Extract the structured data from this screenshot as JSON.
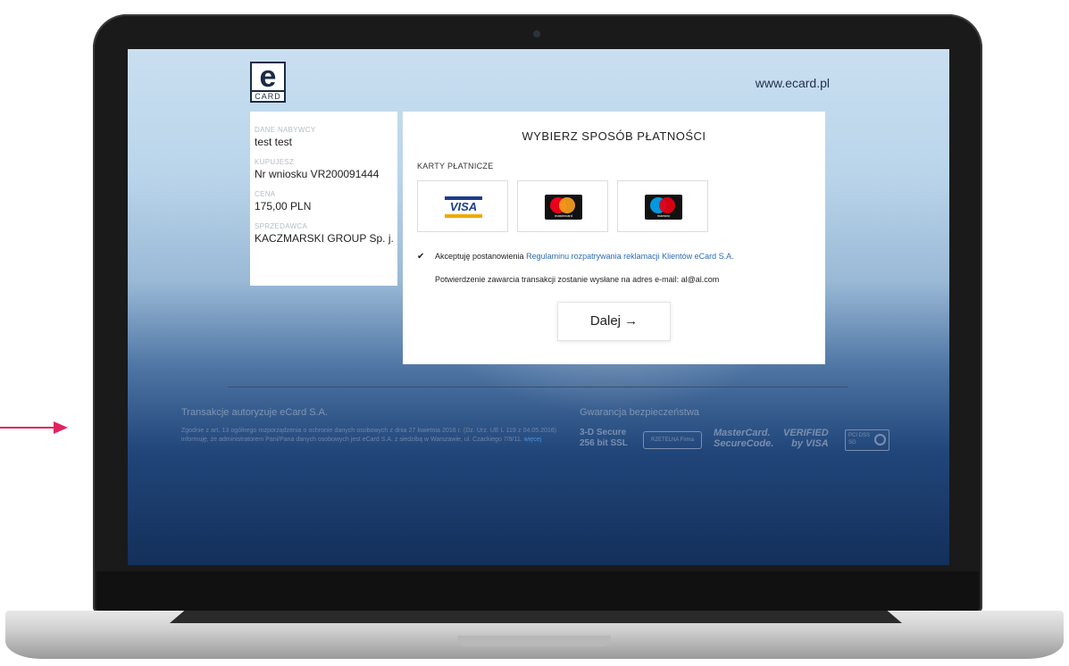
{
  "header": {
    "logo_letter": "e",
    "logo_text": "CARD",
    "site_url": "www.ecard.pl"
  },
  "buyer": {
    "fields": [
      {
        "label": "DANE NABYWCY",
        "value": "test test"
      },
      {
        "label": "KUPUJESZ",
        "value": "Nr wniosku VR200091444"
      },
      {
        "label": "CENA",
        "value": "175,00 PLN"
      },
      {
        "label": "SPRZEDAWCA",
        "value": "KACZMARSKI GROUP Sp. j."
      }
    ]
  },
  "payment": {
    "title": "WYBIERZ SPOSÓB PŁATNOŚCI",
    "cards_label": "KARTY PŁATNICZE",
    "cards": [
      {
        "name": "VISA",
        "icon": "visa-logo-icon"
      },
      {
        "name": "mastercard",
        "icon": "mastercard-logo-icon"
      },
      {
        "name": "maestro",
        "icon": "maestro-logo-icon"
      }
    ],
    "accept_prefix": "Akceptuję postanowienia ",
    "accept_link": "Regulaminu rozpatrywania reklamacji Klientów eCard S.A.",
    "email_note": "Potwierdzenie zawarcia transakcji zostanie wysłane na adres e-mail:  al@al.com",
    "next_label": "Dalej →"
  },
  "footer": {
    "auth_title": "Transakcje autoryzuje eCard S.A.",
    "gdpr_text": "Zgodnie z art. 13 ogólnego rozporządzenia o ochronie danych osobowych z dnia 27 kwietnia 2016 r. (Dz. Urz. UE L 119 z 04.05.2016) informuję, że administratorem Pani/Pana danych osobowych jest eCard S.A. z siedzibą w Warszawie, ul. Czackiego 7/9/11.",
    "gdpr_link": "więcej",
    "security_title": "Gwarancja bezpieczeństwa",
    "badge_3d_line1": "3-D Secure",
    "badge_3d_line2": "256 bit SSL",
    "badge_rzetelna": "RZETELNA Firma",
    "badge_mc_line1": "MasterCard.",
    "badge_mc_line2": "SecureCode.",
    "badge_visa_line1": "VERIFIED",
    "badge_visa_line2": "by VISA",
    "badge_pci_line1": "PCI DSS",
    "badge_pci_line2": "SG"
  },
  "colors": {
    "accent_link": "#2d6cb5",
    "arrow": "#e0245e"
  }
}
